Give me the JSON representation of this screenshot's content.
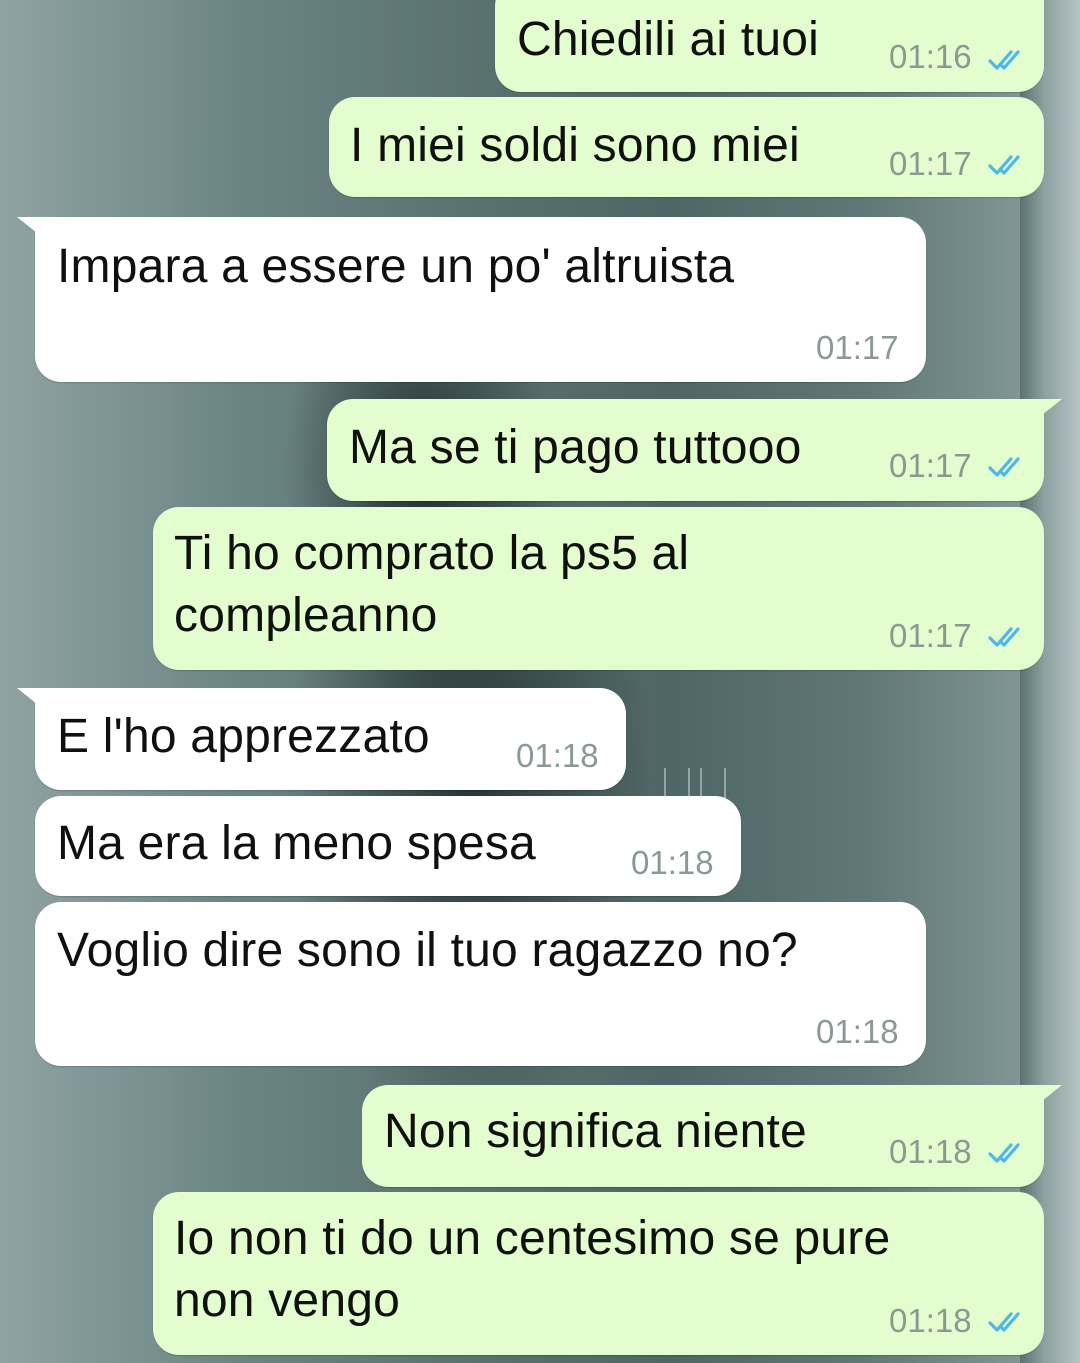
{
  "colors": {
    "outgoing_bubble": "#e3fdcf",
    "incoming_bubble": "#ffffff",
    "read_ticks": "#4fb6ec",
    "timestamp": "#8a9a93"
  },
  "messages": [
    {
      "direction": "outgoing",
      "text": "Chiedili ai tuoi",
      "time": "01:16",
      "status": "read"
    },
    {
      "direction": "outgoing",
      "text": "I miei soldi sono miei",
      "time": "01:17",
      "status": "read"
    },
    {
      "direction": "incoming",
      "text": "Impara a essere un po' altruista",
      "time": "01:17"
    },
    {
      "direction": "outgoing",
      "text": "Ma se ti pago tuttooo",
      "time": "01:17",
      "status": "read"
    },
    {
      "direction": "outgoing",
      "text_line1": "Ti ho comprato la ps5 al",
      "text_line2": "compleanno",
      "time": "01:17",
      "status": "read"
    },
    {
      "direction": "incoming",
      "text": "E l'ho apprezzato",
      "time": "01:18"
    },
    {
      "direction": "incoming",
      "text": "Ma era la meno spesa",
      "time": "01:18"
    },
    {
      "direction": "incoming",
      "text": "Voglio dire sono il tuo ragazzo no?",
      "time": "01:18"
    },
    {
      "direction": "outgoing",
      "text": "Non significa niente",
      "time": "01:18",
      "status": "read"
    },
    {
      "direction": "outgoing",
      "text_line1": "Io non ti do un centesimo se pure",
      "text_line2": "non vengo",
      "time": "01:18",
      "status": "read"
    }
  ]
}
